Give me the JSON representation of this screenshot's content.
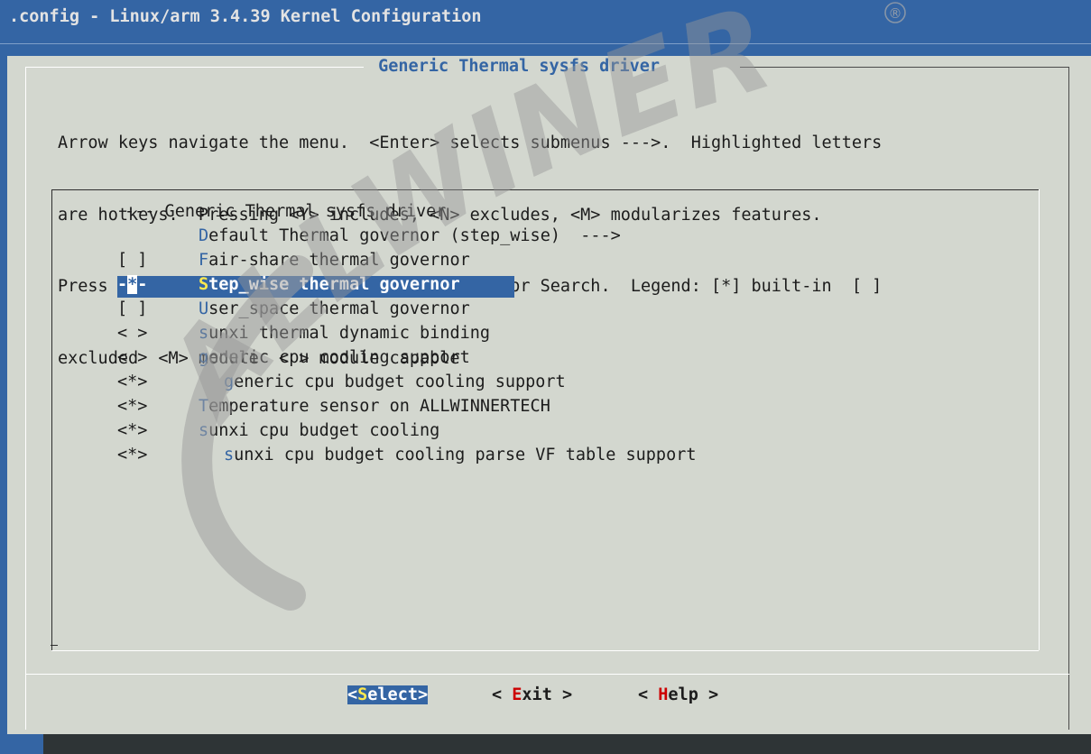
{
  "window": {
    "title": ".config - Linux/arm 3.4.39 Kernel Configuration"
  },
  "dialog": {
    "title": "Generic Thermal sysfs driver",
    "help_lines": [
      "Arrow keys navigate the menu.  <Enter> selects submenus --->.  Highlighted letters",
      "are hotkeys.  Pressing <Y> includes, <N> excludes, <M> modularizes features.",
      "Press <Esc><Esc> to exit, <?> for Help, </> for Search.  Legend: [*] built-in  [ ]",
      "excluded  <M> module  < > module capable"
    ]
  },
  "menu": {
    "items": [
      {
        "mark": "",
        "hot": "",
        "rest": "--- Generic Thermal sysfs driver",
        "level": "header"
      },
      {
        "mark": "",
        "hot": "D",
        "rest": "efault Thermal governor (step_wise)  --->",
        "level": 1
      },
      {
        "mark": "[ ]",
        "hot": "F",
        "rest": "air-share thermal governor",
        "level": 1
      },
      {
        "mark": "-*-",
        "hot": "S",
        "rest": "tep_wise thermal governor",
        "level": 1,
        "selected": true
      },
      {
        "mark": "[ ]",
        "hot": "U",
        "rest": "ser_space thermal governor",
        "level": 1
      },
      {
        "mark": "< >",
        "hot": "s",
        "rest": "unxi thermal dynamic binding",
        "level": 1
      },
      {
        "mark": "< >",
        "hot": "g",
        "rest": "eneric cpu cooling support",
        "level": 1
      },
      {
        "mark": "<*>",
        "hot": "g",
        "rest": "eneric cpu budget cooling support",
        "level": 2
      },
      {
        "mark": "<*>",
        "hot": "T",
        "rest": "emperature sensor on ALLWINNERTECH",
        "level": 1
      },
      {
        "mark": "<*>",
        "hot": "s",
        "rest": "unxi cpu budget cooling",
        "level": 1
      },
      {
        "mark": "<*>",
        "hot": "s",
        "rest": "unxi cpu budget cooling parse VF table support",
        "level": 2
      }
    ]
  },
  "buttons": [
    {
      "left": "<",
      "hot": "S",
      "rest": "elect>",
      "active": true
    },
    {
      "left": "< ",
      "hot": "E",
      "rest": "xit >",
      "active": false
    },
    {
      "left": "< ",
      "hot": "H",
      "rest": "elp >",
      "active": false
    }
  ],
  "watermark": {
    "text": "ALLWINER",
    "symbol": "®"
  },
  "colors": {
    "background_blue": "#3465a4",
    "dialog_gray": "#d3d7cf",
    "highlight_bg": "#3465a4",
    "hotkey_blue": "#3465a4",
    "hotkey_selected": "#fce94f",
    "button_hotkey_red": "#cc0000"
  }
}
